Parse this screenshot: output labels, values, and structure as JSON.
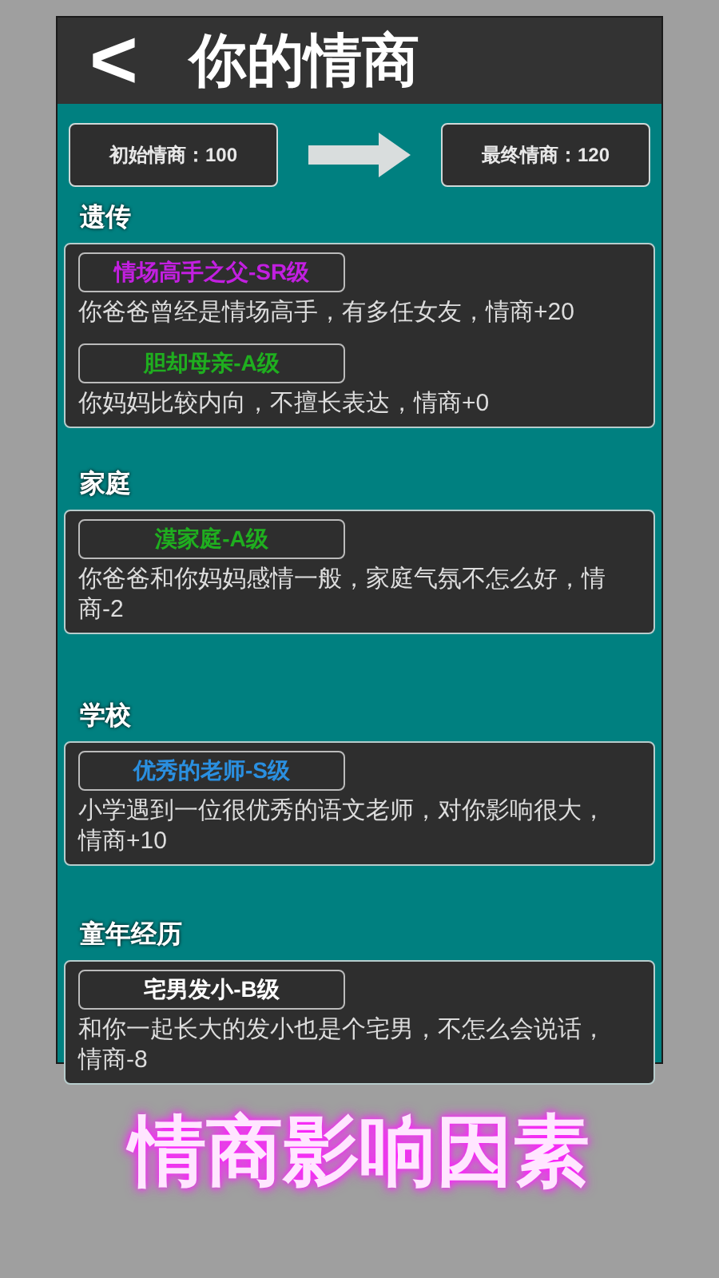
{
  "header": {
    "back": "<",
    "title": "你的情商"
  },
  "summary": {
    "start": "初始情商：100",
    "end": "最终情商：120"
  },
  "sections": [
    {
      "title": "遗传",
      "traits": [
        {
          "name": "情场高手之父-SR级",
          "color": "#c21fe0",
          "description": "你爸爸曾经是情场高手，有多任女友，情商+20"
        },
        {
          "name": "胆却母亲-A级",
          "color": "#1fae1f",
          "description": "你妈妈比较内向，不擅长表达，情商+0"
        }
      ]
    },
    {
      "title": "家庭",
      "traits": [
        {
          "name": "漠家庭-A级",
          "color": "#1fae1f",
          "description": "你爸爸和你妈妈感情一般，家庭气氛不怎么好，情商-2"
        }
      ]
    },
    {
      "title": "学校",
      "traits": [
        {
          "name": "优秀的老师-S级",
          "color": "#2a8fe0",
          "description": "小学遇到一位很优秀的语文老师，对你影响很大，情商+10"
        }
      ]
    },
    {
      "title": "童年经历",
      "traits": [
        {
          "name": "宅男发小-B级",
          "color": "#ffffff",
          "description": "和你一起长大的发小也是个宅男，不怎么会说话，情商-8"
        }
      ]
    }
  ],
  "caption": "情商影响因素"
}
